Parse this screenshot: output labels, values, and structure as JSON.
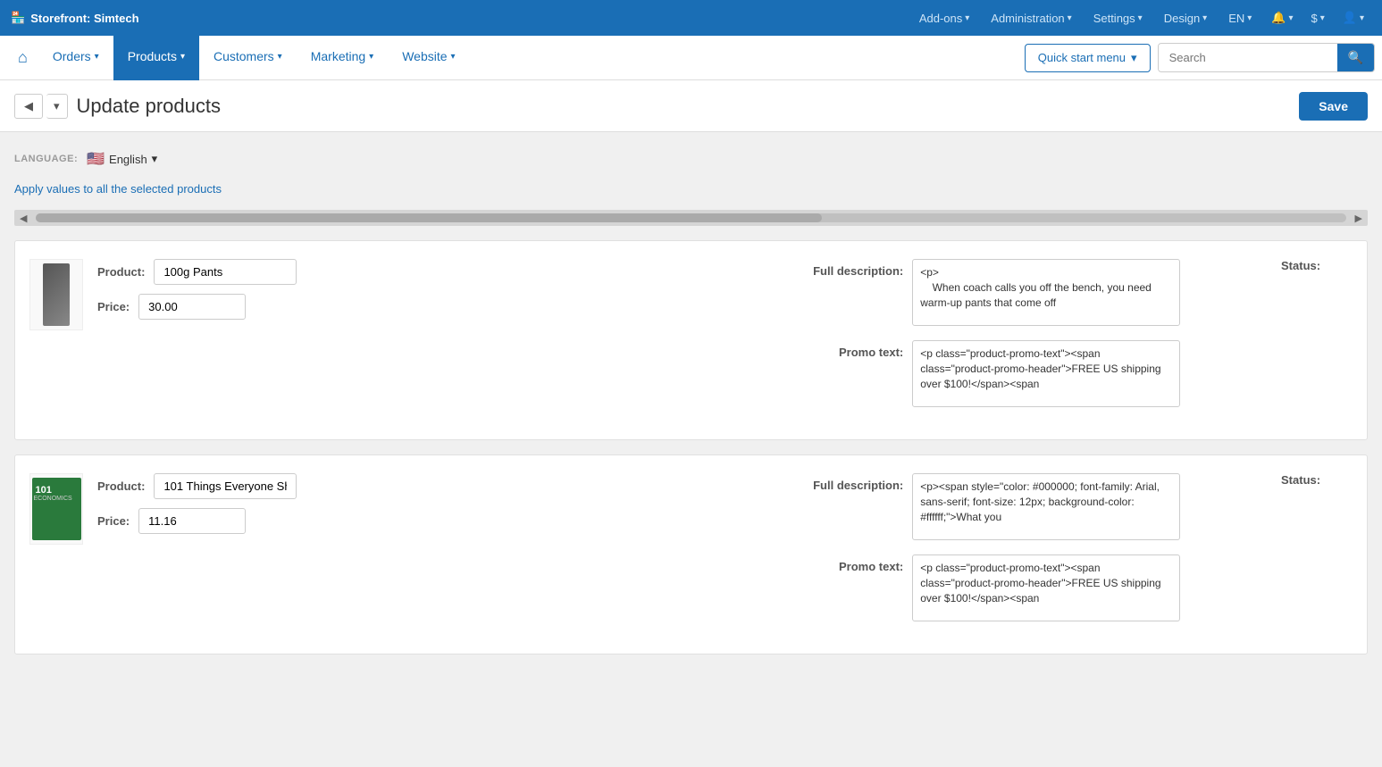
{
  "topbar": {
    "storefront_label": "Storefront: Simtech",
    "store_icon": "🏪",
    "nav_items": [
      {
        "label": "Add-ons",
        "has_dropdown": true
      },
      {
        "label": "Administration",
        "has_dropdown": true
      },
      {
        "label": "Settings",
        "has_dropdown": true
      },
      {
        "label": "Design",
        "has_dropdown": true
      },
      {
        "label": "EN",
        "has_dropdown": true
      }
    ],
    "bell_icon": "🔔",
    "dollar_icon": "$",
    "user_icon": "👤"
  },
  "secondary_nav": {
    "home_icon": "⌂",
    "links": [
      {
        "label": "Orders",
        "has_dropdown": true,
        "active": false
      },
      {
        "label": "Products",
        "has_dropdown": true,
        "active": true
      },
      {
        "label": "Customers",
        "has_dropdown": true,
        "active": false
      },
      {
        "label": "Marketing",
        "has_dropdown": true,
        "active": false
      },
      {
        "label": "Website",
        "has_dropdown": true,
        "active": false
      }
    ],
    "quick_start_label": "Quick start menu",
    "search_placeholder": "Search"
  },
  "page_header": {
    "title": "Update products",
    "back_icon": "◀",
    "dropdown_icon": "▾",
    "save_label": "Save"
  },
  "language_section": {
    "label": "Language:",
    "flag": "🇺🇸",
    "language": "English",
    "dropdown_arrow": "▾"
  },
  "apply_link": "Apply values to all the selected products",
  "products": [
    {
      "id": "product-1",
      "image_type": "pants",
      "name": "100g Pants",
      "price": "30.00",
      "full_description": "<p>\n    When coach calls you off the bench, you need warm-up pants that come off",
      "promo_text": "<p class=\"product-promo-text\"><span class=\"product-promo-header\">FREE US shipping over $100!</span><span"
    },
    {
      "id": "product-2",
      "image_type": "book",
      "name": "101 Things Everyone Sh",
      "price": "11.16",
      "full_description": "<p><span style=\"color: #000000; font-family: Arial, sans-serif; font-size: 12px; background-color: #ffffff;\">What you",
      "promo_text": "<p class=\"product-promo-text\"><span class=\"product-promo-header\">FREE US shipping over $100!</span><span"
    }
  ],
  "labels": {
    "product": "Product:",
    "price": "Price:",
    "full_description": "Full description:",
    "promo_text": "Promo text:",
    "status": "Status:"
  }
}
